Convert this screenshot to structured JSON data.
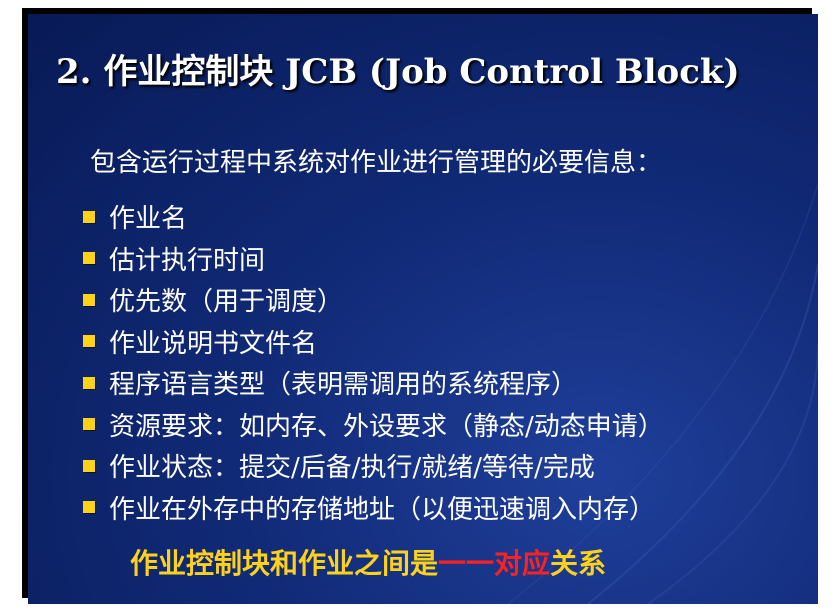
{
  "slide": {
    "title": "2. 作业控制块 JCB (Job Control Block)",
    "intro": "包含运行过程中系统对作业进行管理的必要信息：",
    "bullets": [
      "作业名",
      "估计执行时间",
      "优先数（用于调度）",
      "作业说明书文件名",
      "程序语言类型（表明需调用的系统程序）",
      "资源要求：如内存、外设要求（静态/动态申请）",
      "作业状态：提交/后备/执行/就绪/等待/完成",
      "作业在外存中的存储地址（以便迅速调入内存）"
    ],
    "conclusion": {
      "part_a": "作业控制块和作业之间是",
      "part_b": "一一对应",
      "part_c": "关系"
    }
  },
  "colors": {
    "background": "#112a77",
    "bullet": "#ffd21a",
    "highlight_yellow": "#ffd21a",
    "highlight_red": "#ff2020",
    "text": "#ffffff"
  }
}
